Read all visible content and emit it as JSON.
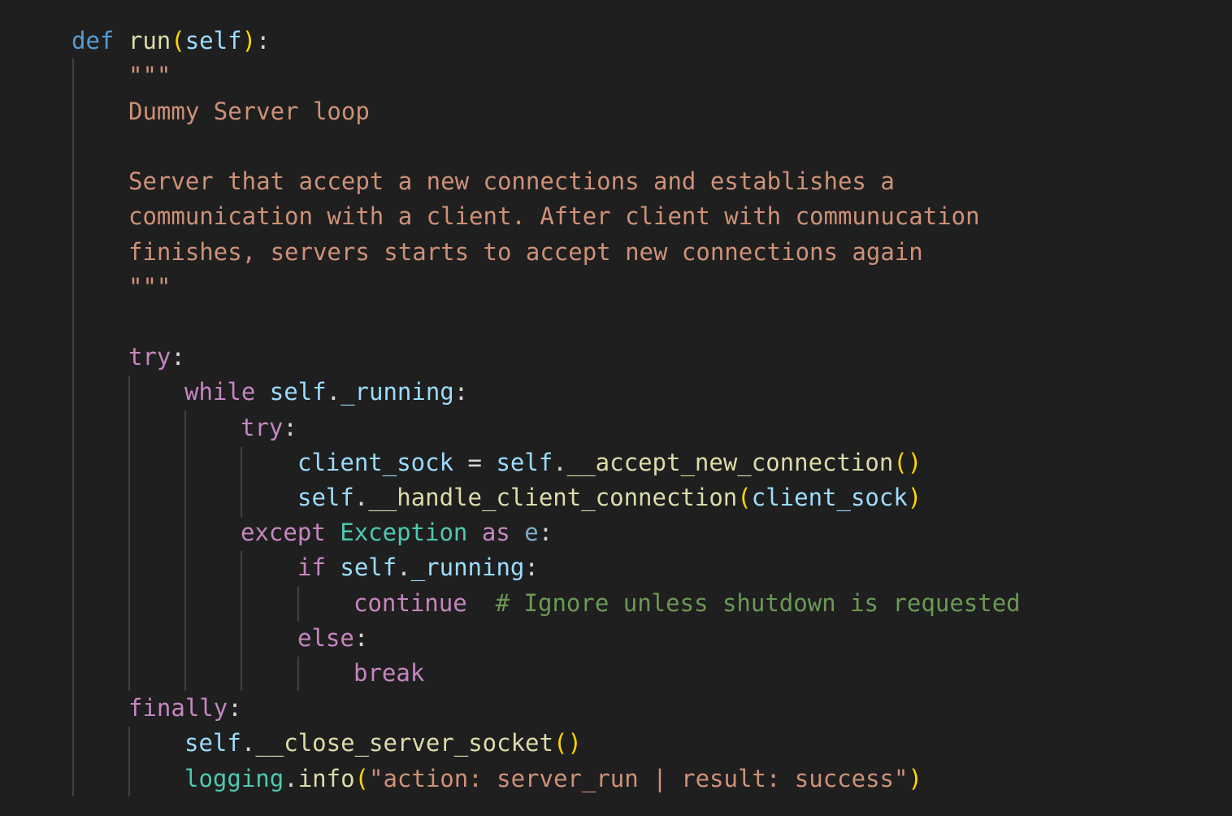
{
  "code": {
    "l1": {
      "kw_def": "def",
      "fn_name": "run",
      "paren_open": "(",
      "param": "self",
      "paren_close": ")",
      "colon": ":"
    },
    "l2": {
      "doc_open": "\"\"\""
    },
    "l3": {
      "doc": "Dummy Server loop"
    },
    "l5": {
      "doc": "Server that accept a new connections and establishes a"
    },
    "l6": {
      "doc": "communication with a client. After client with communucation"
    },
    "l7": {
      "doc": "finishes, servers starts to accept new connections again"
    },
    "l8": {
      "doc_close": "\"\"\""
    },
    "l10": {
      "kw": "try",
      "colon": ":"
    },
    "l11": {
      "kw": "while",
      "self": "self",
      "dot": ".",
      "attr": "_running",
      "colon": ":"
    },
    "l12": {
      "kw": "try",
      "colon": ":"
    },
    "l13": {
      "var": "client_sock",
      "eq": " = ",
      "self": "self",
      "dot": ".",
      "method": "__accept_new_connection",
      "parens": "()"
    },
    "l14": {
      "self": "self",
      "dot": ".",
      "method": "__handle_client_connection",
      "paren_open": "(",
      "arg": "client_sock",
      "paren_close": ")"
    },
    "l15": {
      "kw": "except",
      "cls": "Exception",
      "kw_as": "as",
      "var": "e",
      "colon": ":"
    },
    "l16": {
      "kw": "if",
      "self": "self",
      "dot": ".",
      "attr": "_running",
      "colon": ":"
    },
    "l17": {
      "kw": "continue",
      "comment": "# Ignore unless shutdown is requested"
    },
    "l18": {
      "kw": "else",
      "colon": ":"
    },
    "l19": {
      "kw": "break"
    },
    "l20": {
      "kw": "finally",
      "colon": ":"
    },
    "l21": {
      "self": "self",
      "dot": ".",
      "method": "__close_server_socket",
      "parens": "()"
    },
    "l22": {
      "module": "logging",
      "dot": ".",
      "method": "info",
      "paren_open": "(",
      "string": "\"action: server_run | result: success\"",
      "paren_close": ")"
    }
  },
  "colors": {
    "background": "#1f1f1f",
    "keyword_def": "#569cd6",
    "keyword_control": "#c586c0",
    "function": "#dcdcaa",
    "variable": "#9cdcfe",
    "class": "#4ec9b0",
    "string": "#ce9178",
    "comment": "#6a9955",
    "bracket": "#ffd700"
  }
}
